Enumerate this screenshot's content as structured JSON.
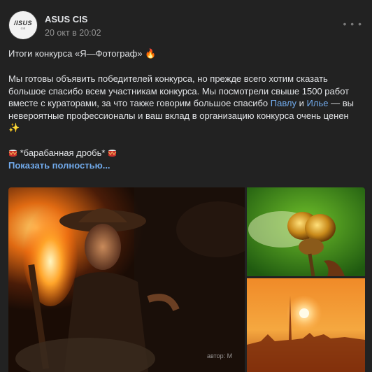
{
  "post": {
    "author": "ASUS CIS",
    "avatar_text": "/ISUS",
    "avatar_sub": "CIS",
    "date": "20 окт в 20:02",
    "title": "Итоги конкурса «Я—Фотограф»",
    "title_emoji": "🔥",
    "body_before_link1": "Мы готовы объявить победителей конкурса, но прежде всего хотим сказать большое спасибо всем  участникам конкурса. Мы посмотрели свыше 1500 работ вместе с кураторами, за что также говорим большое спасибо ",
    "link1": "Павлу",
    "between_links": " и ",
    "link2": "Илье",
    "body_after_links": " — вы невероятные профессионалы и ваш вклад в организацию конкурса очень ценен",
    "sparkle": "✨",
    "drumroll": "*барабанная дробь*",
    "show_more": "Показать полностью...",
    "photo_credit": "автор: М"
  },
  "colors": {
    "background": "#222222",
    "text": "#e1e3e6",
    "muted": "#939393",
    "link": "#71aaeb"
  },
  "icons": {
    "more": "more-dots-icon",
    "fire": "fire-emoji",
    "sparkles": "sparkles-emoji",
    "drum": "drum-emoji"
  }
}
